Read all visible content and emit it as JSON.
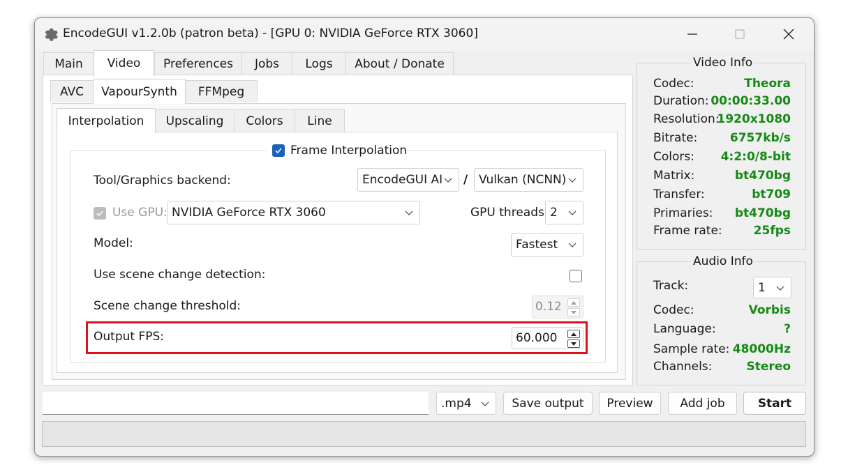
{
  "window": {
    "title": "EncodeGUI v1.2.0b (patron beta) - [GPU 0: NVIDIA GeForce RTX 3060]"
  },
  "main_tabs": [
    "Main",
    "Video",
    "Preferences",
    "Jobs",
    "Logs",
    "About / Donate"
  ],
  "video_tabs": [
    "AVC",
    "VapourSynth",
    "FFMpeg"
  ],
  "vs_tabs": [
    "Interpolation",
    "Upscaling",
    "Colors",
    "Line"
  ],
  "interp": {
    "group_label": "Frame Interpolation",
    "group_checked": true,
    "backend_label": "Tool/Graphics backend:",
    "tool_value": "EncodeGUI AI",
    "separator": "/",
    "backend_value": "Vulkan (NCNN)",
    "use_gpu_label": "Use GPU:",
    "gpu_value": "NVIDIA GeForce RTX 3060",
    "gpu_threads_label": "GPU threads:",
    "gpu_threads_value": "2",
    "model_label": "Model:",
    "model_value": "Fastest",
    "scene_detect_label": "Use scene change detection:",
    "scene_threshold_label": "Scene change threshold:",
    "scene_threshold_value": "0.12",
    "output_fps_label": "Output FPS:",
    "output_fps_value": "60.000"
  },
  "video_info": {
    "title": "Video Info",
    "rows": [
      {
        "k": "Codec:",
        "v": "Theora"
      },
      {
        "k": "Duration:",
        "v": "00:00:33.00"
      },
      {
        "k": "Resolution:",
        "v": "1920x1080"
      },
      {
        "k": "Bitrate:",
        "v": "6757kb/s"
      },
      {
        "k": "Colors:",
        "v": "4:2:0/8-bit"
      },
      {
        "k": "Matrix:",
        "v": "bt470bg"
      },
      {
        "k": "Transfer:",
        "v": "bt709"
      },
      {
        "k": "Primaries:",
        "v": "bt470bg"
      },
      {
        "k": "Frame rate:",
        "v": "25fps"
      }
    ]
  },
  "audio_info": {
    "title": "Audio Info",
    "track_label": "Track:",
    "track_value": "1",
    "rows": [
      {
        "k": "Codec:",
        "v": "Vorbis"
      },
      {
        "k": "Language:",
        "v": "?"
      },
      {
        "k": "Sample rate:",
        "v": "48000Hz"
      },
      {
        "k": "Channels:",
        "v": "Stereo"
      }
    ]
  },
  "bottom": {
    "output_path": "",
    "container_value": ".mp4",
    "save_output": "Save output",
    "preview": "Preview",
    "add_job": "Add job",
    "start": "Start"
  },
  "colors": {
    "accent": "#1e62b8",
    "info_value": "#158a15",
    "highlight": "#e0111b"
  }
}
